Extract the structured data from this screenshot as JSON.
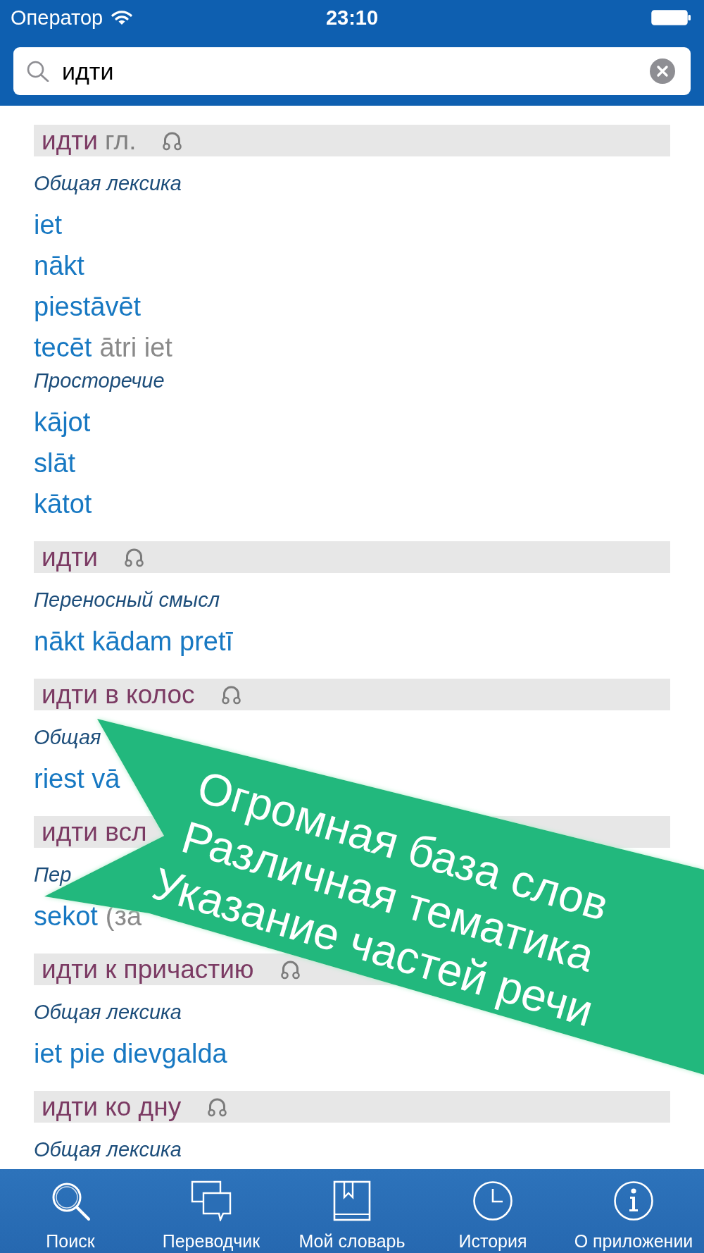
{
  "status_bar": {
    "carrier": "Оператор",
    "time": "23:10"
  },
  "search": {
    "value": "идти"
  },
  "entries": [
    {
      "headword": "идти",
      "part_of_speech": "гл.",
      "audio": true,
      "senses": [
        {
          "label": "Общая лексика",
          "translations": [
            {
              "text": "iet"
            },
            {
              "text": "nākt"
            },
            {
              "text": "piestāvēt"
            },
            {
              "text": "tecēt",
              "note": "ātri iet"
            }
          ]
        },
        {
          "label": "Просторечие",
          "translations": [
            {
              "text": "kājot"
            },
            {
              "text": "slāt"
            },
            {
              "text": "kātot"
            }
          ]
        }
      ]
    },
    {
      "headword": "идти",
      "audio": true,
      "senses": [
        {
          "label": "Переносный смысл",
          "translations": [
            {
              "text": "nākt kādam pretī"
            }
          ]
        }
      ]
    },
    {
      "headword": "идти в колос",
      "audio": true,
      "senses": [
        {
          "label": "Общая",
          "translations": [
            {
              "text": "riest vā"
            }
          ]
        }
      ]
    },
    {
      "headword": "идти всл",
      "audio": false,
      "senses": [
        {
          "label": "Пер",
          "translations": [
            {
              "text": "sekot",
              "note": "(за"
            }
          ]
        }
      ]
    },
    {
      "headword": "идти к причастию",
      "audio": true,
      "senses": [
        {
          "label": "Общая лексика",
          "translations": [
            {
              "text": "iet pie dievgalda"
            }
          ]
        }
      ]
    },
    {
      "headword": "идти ко дну",
      "audio": true,
      "senses": [
        {
          "label": "Общая лексика"
        }
      ]
    }
  ],
  "promo_banner": {
    "lines": [
      "Огромная база слов",
      "Различная тематика",
      "Указание частей речи"
    ]
  },
  "tab_bar": {
    "tabs": [
      {
        "label": "Поиск",
        "selected": false
      },
      {
        "label": "Переводчик",
        "selected": false
      },
      {
        "label": "Мой словарь",
        "selected": false
      },
      {
        "label": "История",
        "selected": false
      },
      {
        "label": "О приложении",
        "selected": false
      }
    ]
  }
}
